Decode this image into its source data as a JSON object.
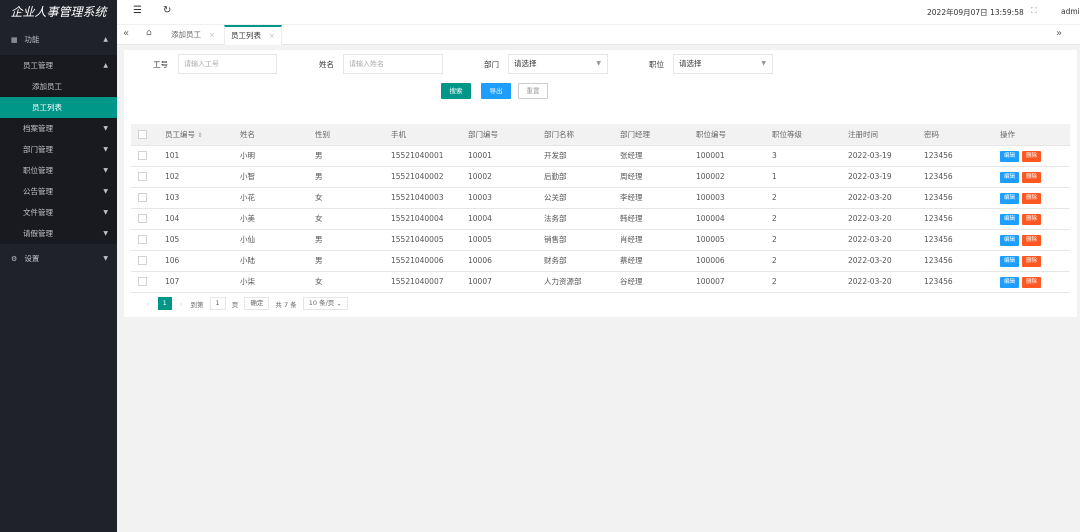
{
  "sidebar": {
    "title": "企业人事管理系统",
    "menu": [
      {
        "label": "功能",
        "icon": "grid-icon"
      },
      {
        "label": "设置",
        "icon": "gear-icon"
      }
    ],
    "employee_group": "员工管理",
    "employee_sub": [
      "添加员工",
      "员工列表"
    ],
    "sections": [
      "档案管理",
      "部门管理",
      "职位管理",
      "公告管理",
      "文件管理",
      "请假管理"
    ]
  },
  "header": {
    "datetime": "2022年09月07日  13:59:58",
    "user": "admin"
  },
  "tabs": [
    "添加员工",
    "员工列表"
  ],
  "filters": {
    "job_no_label": "工号",
    "job_no_placeholder": "请输入工号",
    "name_label": "姓名",
    "name_placeholder": "请输入姓名",
    "dept_label": "部门",
    "dept_value": "请选择",
    "position_label": "职位",
    "position_value": "请选择"
  },
  "buttons": {
    "search": "搜索",
    "export": "导出",
    "reset": "重置"
  },
  "table": {
    "columns": [
      "员工编号",
      "姓名",
      "性别",
      "手机",
      "部门编号",
      "部门名称",
      "部门经理",
      "职位编号",
      "职位等级",
      "注册时间",
      "密码",
      "操作"
    ],
    "edit_label": "编辑",
    "delete_label": "删除",
    "rows": [
      [
        "101",
        "小明",
        "男",
        "15521040001",
        "10001",
        "开发部",
        "张经理",
        "100001",
        "3",
        "2022-03-19",
        "123456"
      ],
      [
        "102",
        "小智",
        "男",
        "15521040002",
        "10002",
        "后勤部",
        "周经理",
        "100002",
        "1",
        "2022-03-19",
        "123456"
      ],
      [
        "103",
        "小花",
        "女",
        "15521040003",
        "10003",
        "公关部",
        "李经理",
        "100003",
        "2",
        "2022-03-20",
        "123456"
      ],
      [
        "104",
        "小美",
        "女",
        "15521040004",
        "10004",
        "法务部",
        "韩经理",
        "100004",
        "2",
        "2022-03-20",
        "123456"
      ],
      [
        "105",
        "小仙",
        "男",
        "15521040005",
        "10005",
        "销售部",
        "肖经理",
        "100005",
        "2",
        "2022-03-20",
        "123456"
      ],
      [
        "106",
        "小陆",
        "男",
        "15521040006",
        "10006",
        "财务部",
        "蔡经理",
        "100006",
        "2",
        "2022-03-20",
        "123456"
      ],
      [
        "107",
        "小柒",
        "女",
        "15521040007",
        "10007",
        "人力资源部",
        "谷经理",
        "100007",
        "2",
        "2022-03-20",
        "123456"
      ]
    ]
  },
  "pager": {
    "current": "1",
    "goto": "到第",
    "page_input": "1",
    "page_unit": "页",
    "confirm": "确定",
    "total": "共 7 条",
    "per_page": "10 条/页"
  }
}
